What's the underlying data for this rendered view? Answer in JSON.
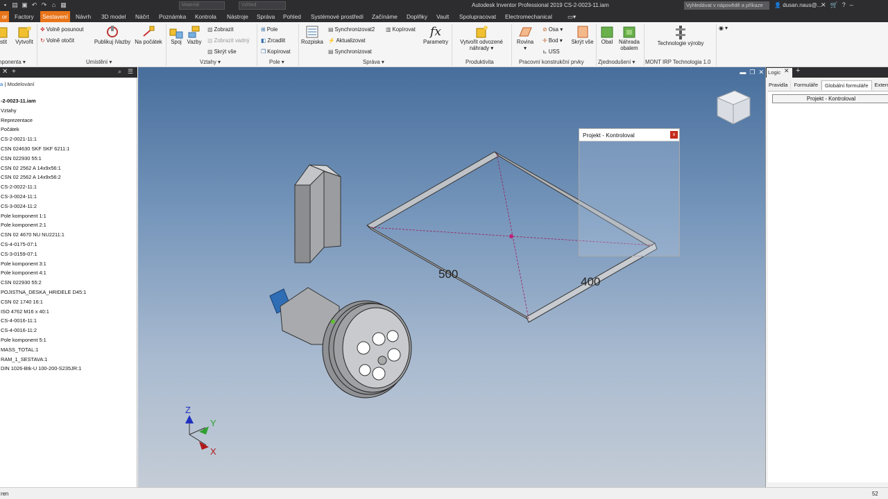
{
  "titlebar": {
    "combo1": "Materiál",
    "combo2": "Vzhled",
    "title": "Autodesk Inventor Professional 2019    CS-2-0023-11.iam",
    "search_placeholder": "Vyhledávat v nápovědě a příkaze",
    "user": "dusan.naus@...",
    "icons": [
      "new-icon",
      "open-icon",
      "save-icon",
      "undo-icon",
      "redo-icon",
      "home-icon",
      "print-icon"
    ]
  },
  "menu": {
    "tabs": [
      "or",
      "Factory",
      "Sestavení",
      "Návrh",
      "3D model",
      "Náčrt",
      "Poznámka",
      "Kontrola",
      "Nástroje",
      "Správa",
      "Pohled",
      "Systémové prostředí",
      "Začínáme",
      "Doplňky",
      "Vault",
      "Spolupracovat",
      "Electromechanical"
    ],
    "active": "Sestavení"
  },
  "ribbon": {
    "komponenta": {
      "btn_stit": "stit",
      "btn_vytvorit": "Vytvořit",
      "label": "mponenta"
    },
    "umisteni": {
      "volne_posunout": "Volně posunout",
      "volne_otocit": "Volně otočit",
      "publikuj": "Publikuj iVazby",
      "na_pocatek": "Na počátek",
      "label": "Umístění"
    },
    "vztahy": {
      "spoj": "Spoj",
      "vazby": "Vazby",
      "zobrazit": "Zobrazit",
      "zobrazit_vadny": "Zobrazit vadný",
      "skryt_vse": "Skrýt vše",
      "label": "Vztahy"
    },
    "pole": {
      "pole": "Pole",
      "zrcadlit": "Zrcadlit",
      "kopirovat": "Kopírovat",
      "label": "Pole"
    },
    "sprava": {
      "rozpiska": "Rozpiska",
      "synchronizovat2": "Synchronizovat2",
      "aktualizovat": "Aktualizovat",
      "synchronizovat": "Synchronizovat",
      "kopirovat": "Kopírovat",
      "parametry": "Parametry",
      "label": "Správa"
    },
    "produktivita": {
      "vytvorit_odvozene": "Vytvořit odvozené",
      "nahrady": "náhrady",
      "label": "Produktivita"
    },
    "prvky": {
      "rovina": "Rovina",
      "osa": "Osa",
      "bod": "Bod",
      "uss": "USS",
      "label": "Pracovní konstrukční prvky"
    },
    "zjednoduseni": {
      "skryt_vse": "Skrýt vše",
      "obal": "Obal",
      "nahrada": "Náhrada",
      "obalem": "obalem",
      "label": "Zjednodušení"
    },
    "mont": {
      "technologie": "Technologie výroby",
      "label": "MONT IRP Technologia 1.0"
    }
  },
  "browser": {
    "crumb_link": "a",
    "crumb": "Modelování",
    "items": [
      "-2-0023-11.iam",
      "Vztahy",
      "Reprezentace",
      "Počátek",
      "CS-2-0021-11:1",
      "CSN 024630 SKF SKF 6211:1",
      "CSN 022930 55:1",
      "CSN 02 2562 A 14x9x56:1",
      "CSN 02 2562 A 14x9x56:2",
      "CS-2-0022-11:1",
      "CS-3-0024-11:1",
      "CS-3-0024-11:2",
      "Pole komponent 1:1",
      "Pole komponent 2:1",
      "CSN 02 4670 NU NU2211:1",
      "CS-4-0175-07:1",
      "CS-3-0159-07:1",
      "Pole komponent 3:1",
      "Pole komponent 4:1",
      "CSN 022930 55:2",
      "POJISTNA_DESKA_HRIDELE D45:1",
      "CSN 02 1740 16:1",
      "ISO 4762 M16 x 40:1",
      "CS-4-0016-11:1",
      "CS-4-0016-11:2",
      "Pole komponent 5:1",
      "MASS_TOTAL:1",
      "RAM_1_SESTAVA:1",
      "DIN 1026-Btk-U 100-200-S235JR:1"
    ]
  },
  "viewport": {
    "dim1": "500",
    "dim2": "400",
    "axis_x": "X",
    "axis_y": "Y",
    "axis_z": "Z",
    "dialog_title": "Projekt - Kontroloval",
    "dialog_close": "x"
  },
  "rightpanel": {
    "tab": "Logic",
    "subtabs": [
      "Pravidla",
      "Formuláře",
      "Globální formuláře",
      "Externí p"
    ],
    "active_subtab": "Globální formuláře",
    "form_button": "Projekt - Kontroloval"
  },
  "status": {
    "left": "ren",
    "right": "52"
  },
  "colors": {
    "accent": "#e8751a",
    "dark": "#2d2d30",
    "viewport_top": "#476e9c",
    "viewport_bottom": "#c4ccd6"
  }
}
